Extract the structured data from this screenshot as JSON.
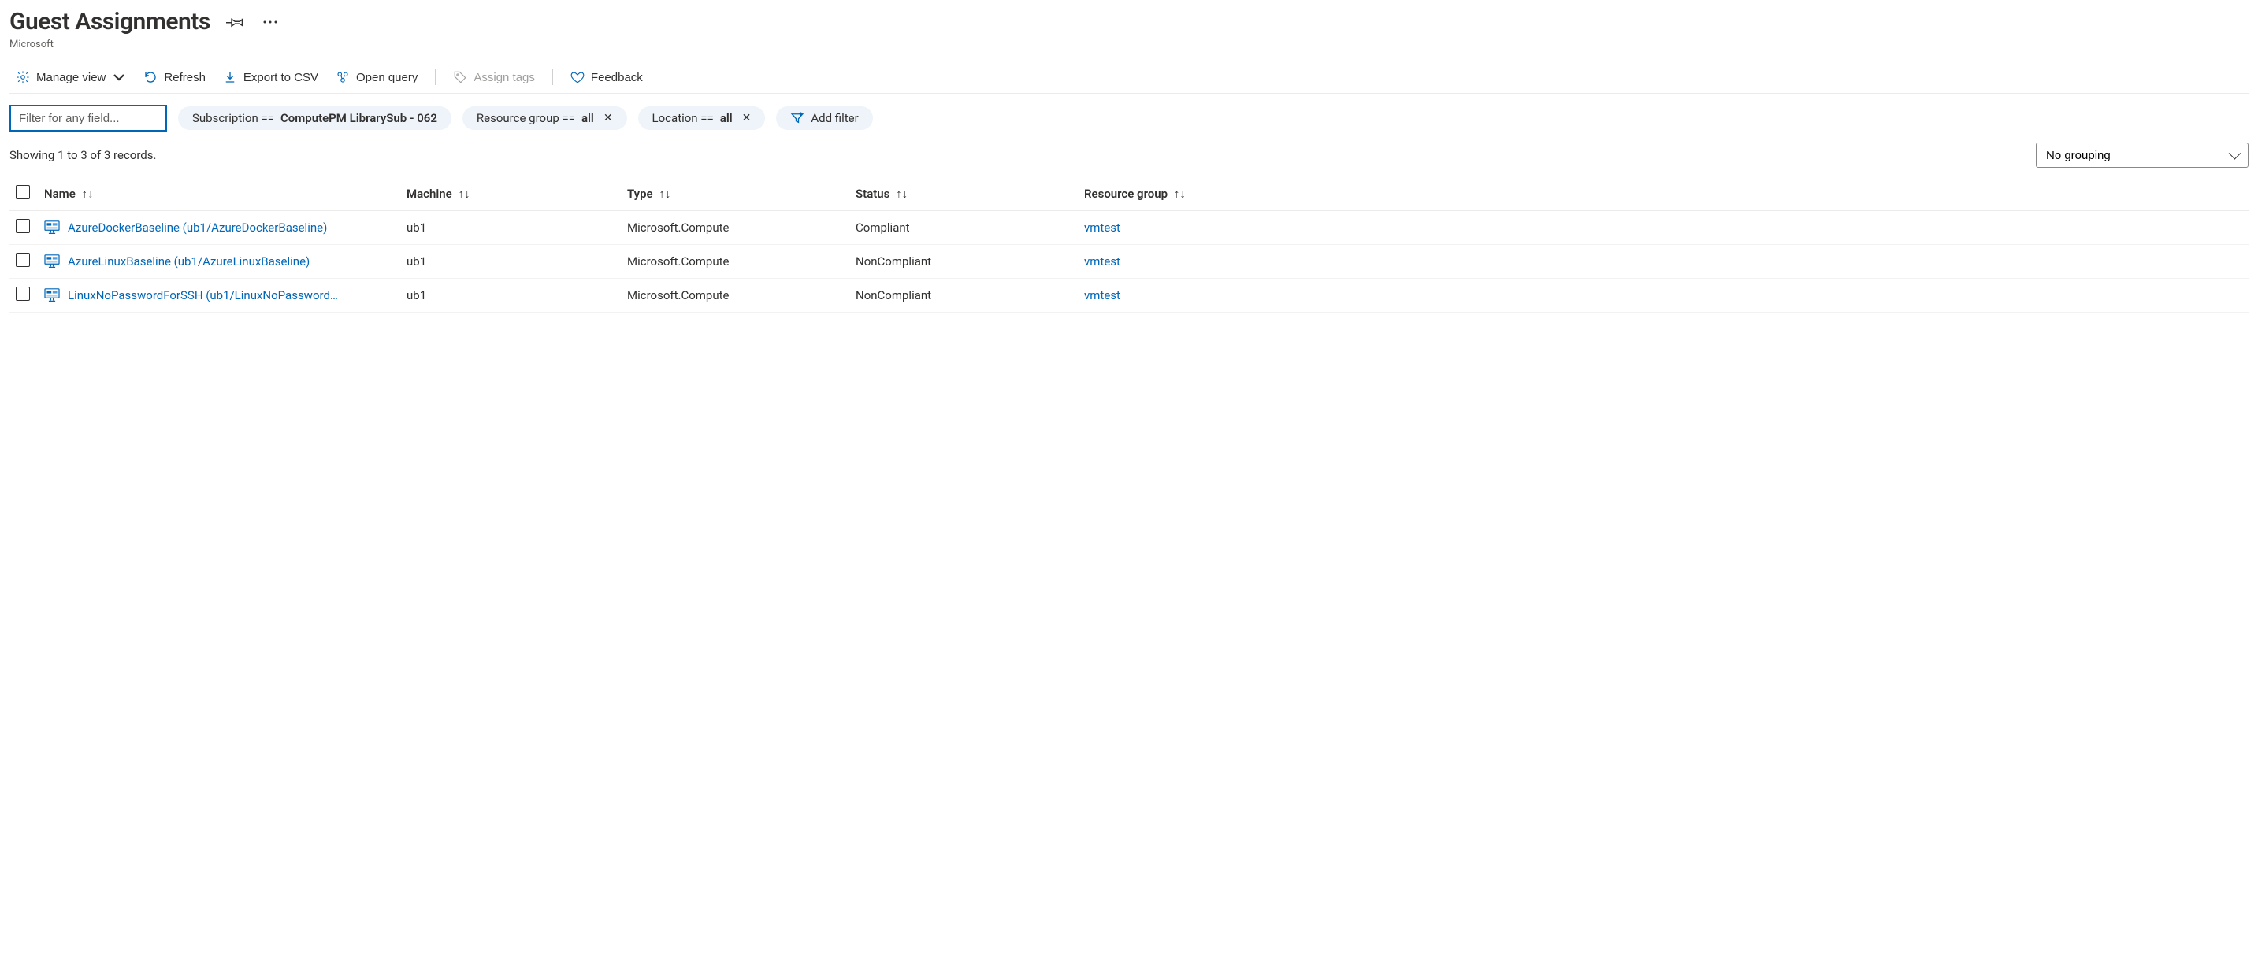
{
  "header": {
    "title": "Guest Assignments",
    "subtitle": "Microsoft"
  },
  "toolbar": {
    "manage_view": "Manage view",
    "refresh": "Refresh",
    "export_csv": "Export to CSV",
    "open_query": "Open query",
    "assign_tags": "Assign tags",
    "feedback": "Feedback"
  },
  "filters": {
    "input_placeholder": "Filter for any field...",
    "subscription_label": "Subscription == ",
    "subscription_value": "ComputePM LibrarySub - 062",
    "resource_group_label": "Resource group == ",
    "resource_group_value": "all",
    "location_label": "Location == ",
    "location_value": "all",
    "add_filter": "Add filter"
  },
  "records": {
    "summary": "Showing 1 to 3 of 3 records.",
    "grouping": "No grouping"
  },
  "columns": {
    "name": "Name",
    "machine": "Machine",
    "type": "Type",
    "status": "Status",
    "resource_group": "Resource group"
  },
  "rows": [
    {
      "name": "AzureDockerBaseline (ub1/AzureDockerBaseline)",
      "machine": "ub1",
      "type": "Microsoft.Compute",
      "status": "Compliant",
      "resource_group": "vmtest"
    },
    {
      "name": "AzureLinuxBaseline (ub1/AzureLinuxBaseline)",
      "machine": "ub1",
      "type": "Microsoft.Compute",
      "status": "NonCompliant",
      "resource_group": "vmtest"
    },
    {
      "name": "LinuxNoPasswordForSSH (ub1/LinuxNoPassword…",
      "machine": "ub1",
      "type": "Microsoft.Compute",
      "status": "NonCompliant",
      "resource_group": "vmtest"
    }
  ]
}
